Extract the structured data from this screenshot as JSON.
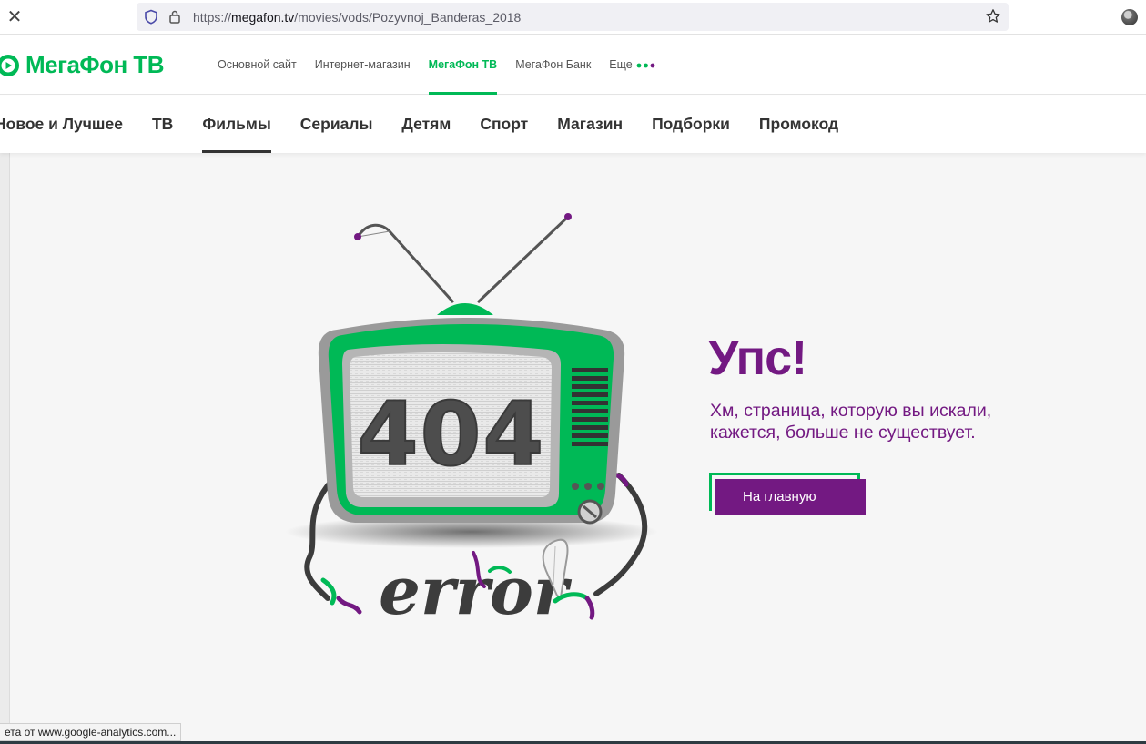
{
  "browser": {
    "url_scheme": "https://",
    "url_host": "megafon.tv",
    "url_path": "/movies/vods/Pozyvnoj_Banderas_2018",
    "status_text": "ета от www.google-analytics.com..."
  },
  "header": {
    "logo_text": "МегаФон ТВ",
    "links": [
      {
        "label": "Основной сайт"
      },
      {
        "label": "Интернет-магазин"
      },
      {
        "label": "МегаФон ТВ",
        "active": true
      },
      {
        "label": "МегаФон Банк"
      },
      {
        "label": "Еще"
      }
    ]
  },
  "nav": {
    "items": [
      {
        "label": "Новое и Лучшее"
      },
      {
        "label": "ТВ"
      },
      {
        "label": "Фильмы",
        "active": true
      },
      {
        "label": "Сериалы"
      },
      {
        "label": "Детям"
      },
      {
        "label": "Спорт"
      },
      {
        "label": "Магазин"
      },
      {
        "label": "Подборки"
      },
      {
        "label": "Промокод"
      }
    ]
  },
  "error": {
    "code": "404",
    "word": "error",
    "title": "Упс!",
    "message": "Хм, страница, которую вы искали, кажется, больше не существует.",
    "home_button": "На главную"
  },
  "colors": {
    "brand_green": "#00b956",
    "brand_purple": "#731982"
  },
  "icons": [
    "close-icon",
    "shield-icon",
    "lock-icon",
    "star-icon",
    "profile-avatar",
    "megafon-logo-icon",
    "more-dots-icon"
  ]
}
